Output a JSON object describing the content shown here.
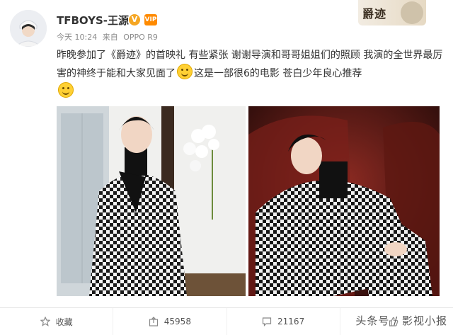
{
  "header": {
    "username": "TFBOYS-王源",
    "badge": "V",
    "vip": "VIP",
    "time": "今天 10:24",
    "source_prefix": "来自",
    "source": "OPPO R9"
  },
  "promo": {
    "text": "爵迹"
  },
  "post": {
    "part1": "昨晚参加了《爵迹》的首映礼 有些紧张 谢谢导演和哥哥姐姐们的照顾 我演的全世界最厉害的神终于能和大家见面了",
    "part2": "这是一部很6的电影 苍白少年良心推荐"
  },
  "actions": [
    {
      "label": "收藏",
      "icon": "star-icon"
    },
    {
      "label": "45958",
      "icon": "share-icon"
    },
    {
      "label": "21167",
      "icon": "comment-icon"
    },
    {
      "label": "",
      "icon": "like-icon"
    }
  ],
  "watermark": "头条号 / 影视小报",
  "colors": {
    "accent": "#f5a623",
    "vip": "#ff8a00",
    "text": "#333333",
    "meta": "#8a8a8a"
  }
}
